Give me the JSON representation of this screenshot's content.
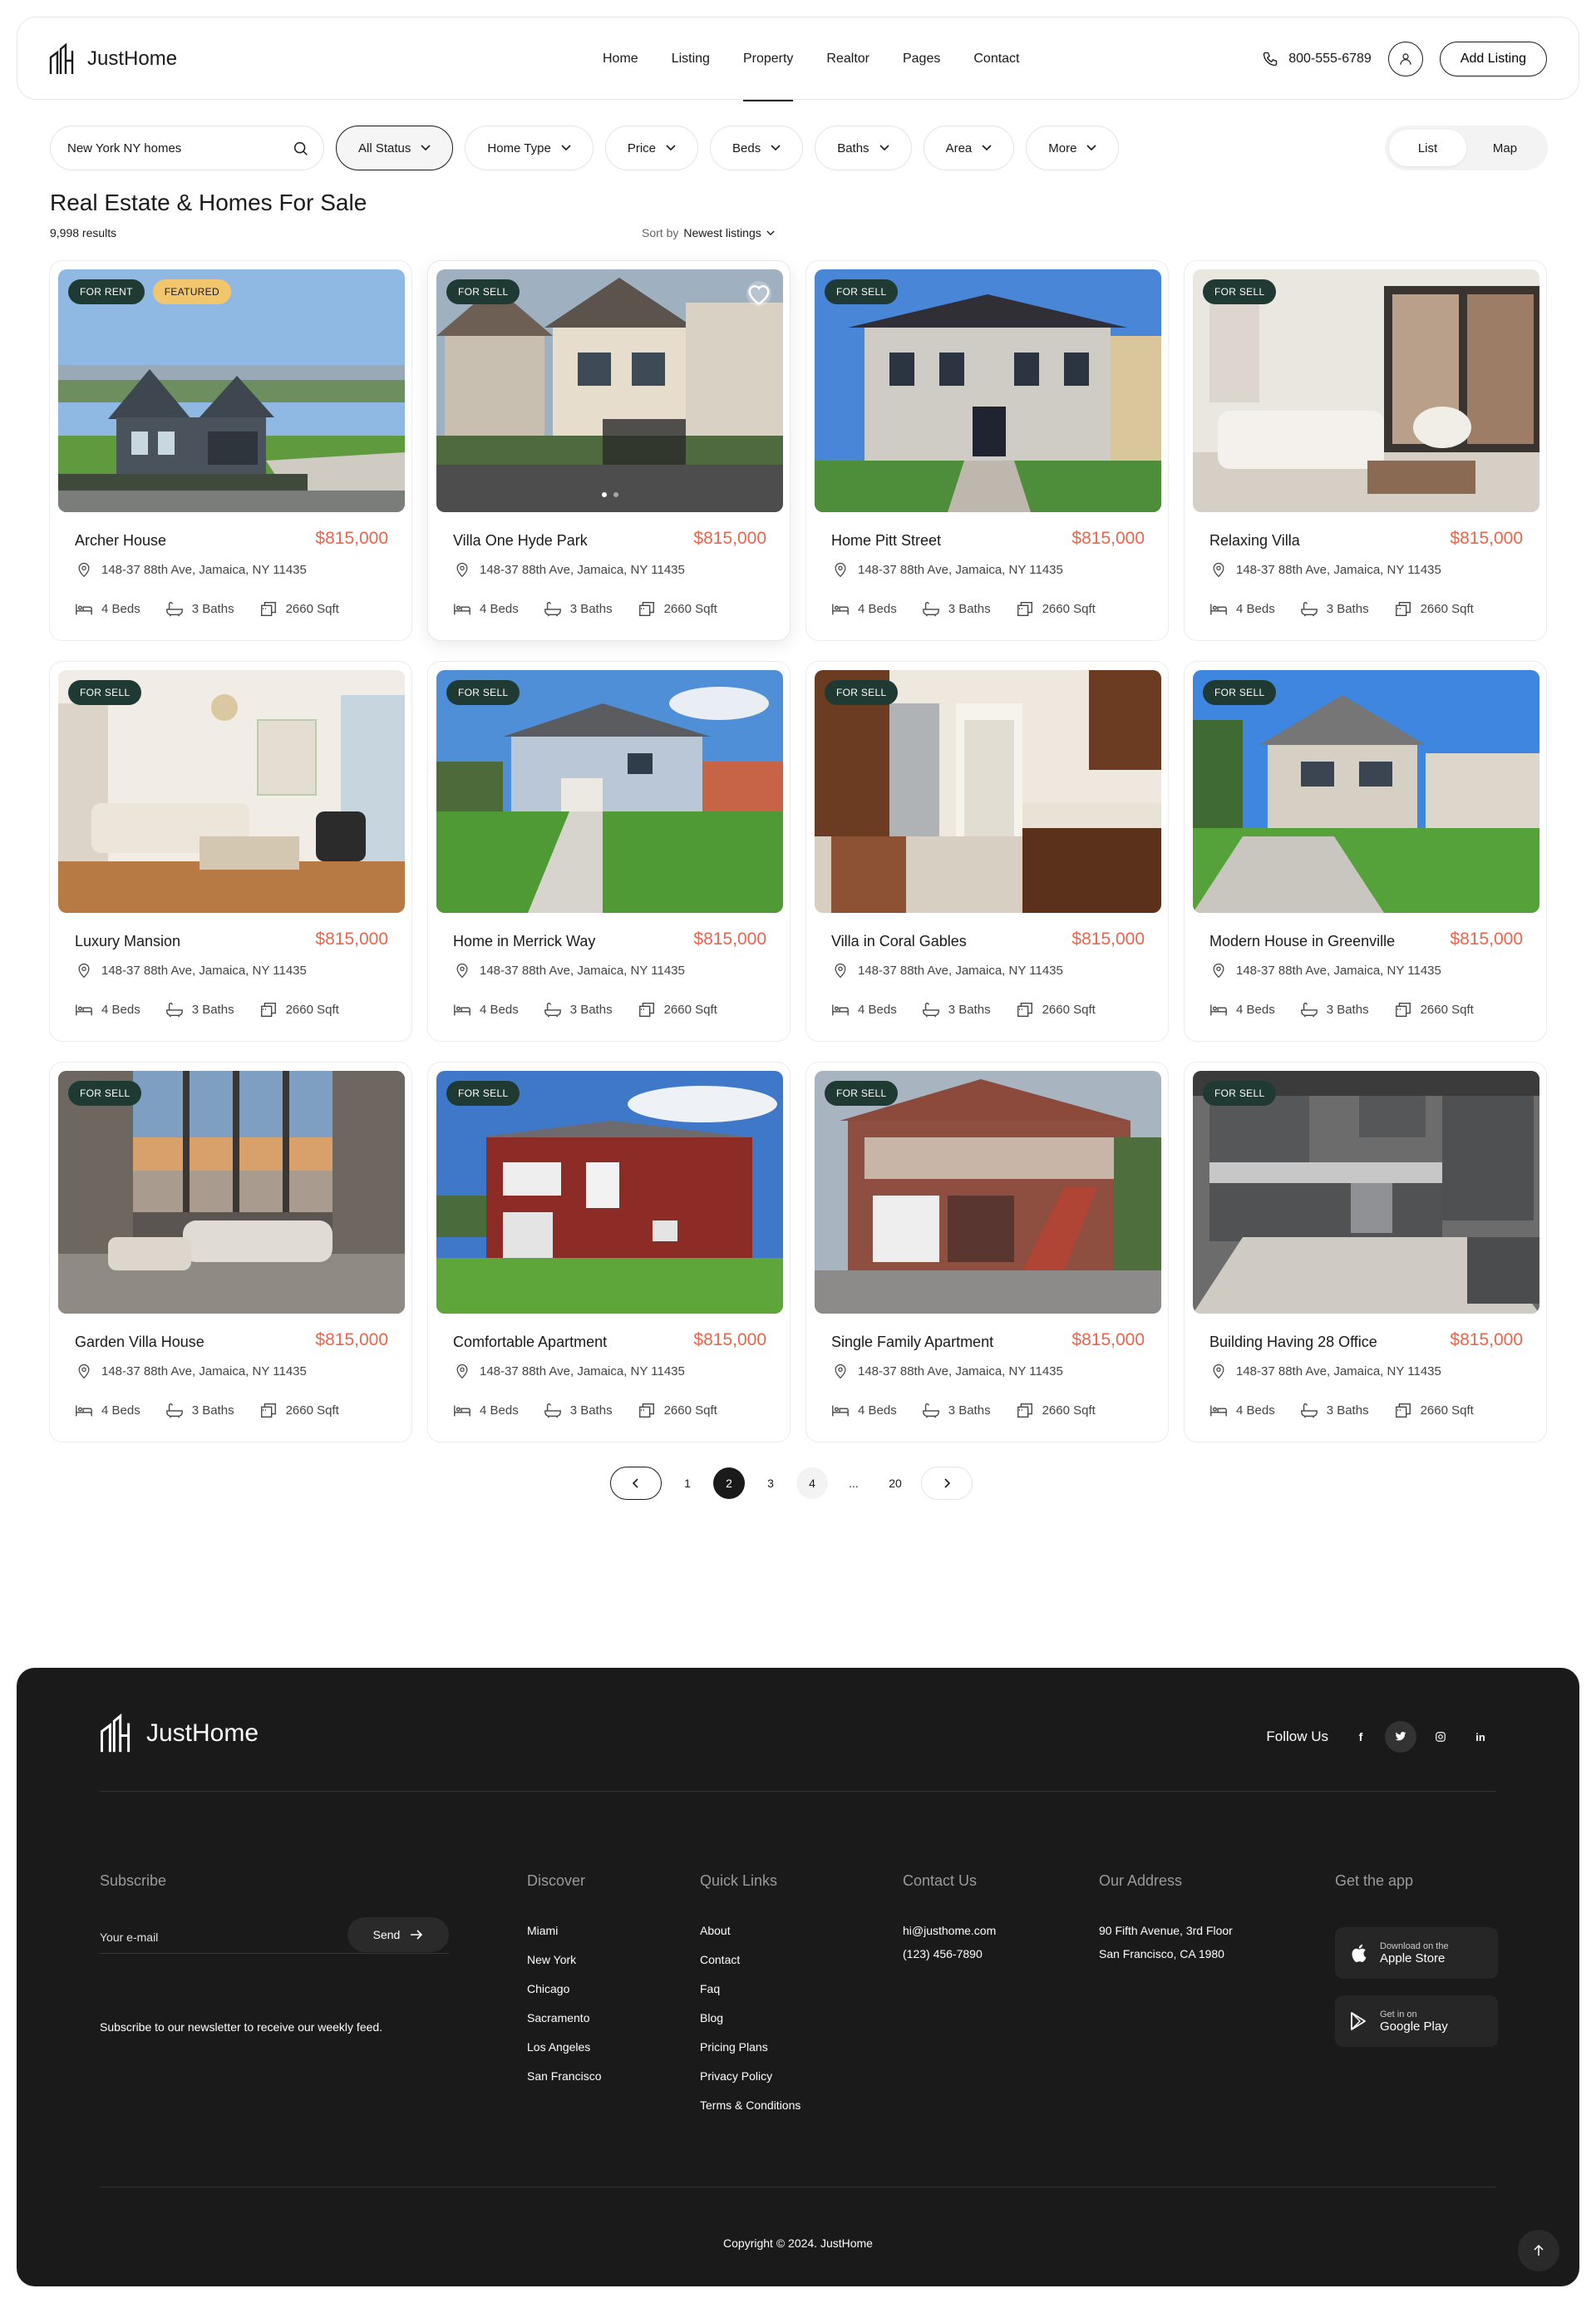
{
  "header": {
    "brand": "JustHome",
    "nav": [
      "Home",
      "Listing",
      "Property",
      "Realtor",
      "Pages",
      "Contact"
    ],
    "active_nav": "Property",
    "phone": "800-555-6789",
    "add_listing": "Add Listing"
  },
  "filters": {
    "search_value": "New York NY homes",
    "chips": [
      "All Status",
      "Home Type",
      "Price",
      "Beds",
      "Baths",
      "Area",
      "More"
    ],
    "selected_chip": "All Status",
    "view_options": [
      "List",
      "Map"
    ],
    "active_view": "List"
  },
  "listing": {
    "title": "Real Estate & Homes For Sale",
    "results": "9,998 results",
    "sort_label": "Sort by",
    "sort_value": "Newest listings"
  },
  "cards": [
    {
      "name": "Archer House",
      "price": "$815,000",
      "badges": [
        "FOR RENT",
        "FEATURED"
      ],
      "scene": "modern-dark-house"
    },
    {
      "name": "Villa One Hyde Park",
      "price": "$815,000",
      "badges": [
        "FOR SELL"
      ],
      "scene": "street-houses"
    },
    {
      "name": "Home Pitt Street",
      "price": "$815,000",
      "badges": [
        "FOR SELL"
      ],
      "scene": "mansion"
    },
    {
      "name": "Relaxing Villa",
      "price": "$815,000",
      "badges": [
        "FOR SELL"
      ],
      "scene": "living-room-white"
    },
    {
      "name": "Luxury Mansion",
      "price": "$815,000",
      "badges": [
        "FOR SELL"
      ],
      "scene": "living-room-warm"
    },
    {
      "name": "Home in Merrick Way",
      "price": "$815,000",
      "badges": [
        "FOR SELL"
      ],
      "scene": "suburban-house"
    },
    {
      "name": "Villa in Coral Gables",
      "price": "$815,000",
      "badges": [
        "FOR SELL"
      ],
      "scene": "kitchen-wood"
    },
    {
      "name": "Modern House in Greenville",
      "price": "$815,000",
      "badges": [
        "FOR SELL"
      ],
      "scene": "suburban-house-2"
    },
    {
      "name": "Garden Villa House",
      "price": "$815,000",
      "badges": [
        "FOR SELL"
      ],
      "scene": "penthouse"
    },
    {
      "name": "Comfortable Apartment",
      "price": "$815,000",
      "badges": [
        "FOR SELL"
      ],
      "scene": "red-house"
    },
    {
      "name": "Single Family Apartment",
      "price": "$815,000",
      "badges": [
        "FOR SELL"
      ],
      "scene": "brick-house"
    },
    {
      "name": "Building Having 28 Office",
      "price": "$815,000",
      "badges": [
        "FOR SELL"
      ],
      "scene": "kitchen-grey"
    }
  ],
  "card_common": {
    "address": "148-37 88th Ave, Jamaica, NY 11435",
    "beds": "4 Beds",
    "baths": "3 Baths",
    "area": "2660 Sqft"
  },
  "pagination": {
    "pages": [
      "1",
      "2",
      "3",
      "4",
      "...",
      "20"
    ],
    "current": "2"
  },
  "footer": {
    "brand": "JustHome",
    "follow_label": "Follow Us",
    "social_icons": [
      "facebook-icon",
      "twitter-icon",
      "instagram-icon",
      "linkedin-icon"
    ],
    "subscribe": {
      "title": "Subscribe",
      "placeholder": "Your e-mail",
      "button": "Send",
      "note": "Subscribe to our newsletter to receive our weekly feed."
    },
    "discover": {
      "title": "Discover",
      "items": [
        "Miami",
        "New York",
        "Chicago",
        "Sacramento",
        "Los Angeles",
        "San Francisco"
      ]
    },
    "quick_links": {
      "title": "Quick Links",
      "items": [
        "About",
        "Contact",
        "Faq",
        "Blog",
        "Pricing Plans",
        "Privacy Policy",
        "Terms & Conditions"
      ]
    },
    "contact": {
      "title": "Contact Us",
      "items": [
        "hi@justhome.com",
        "(123) 456-7890"
      ]
    },
    "address": {
      "title": "Our Address",
      "items": [
        "90 Fifth Avenue, 3rd Floor",
        "San Francisco, CA 1980"
      ]
    },
    "app": {
      "title": "Get the app",
      "apple_small": "Download on the",
      "apple_large": "Apple Store",
      "google_small": "Get in on",
      "google_large": "Google Play"
    },
    "copyright": "Copyright © 2024. JustHome"
  },
  "colors": {
    "accent_price": "#e8664d",
    "badge_status": "#1f3a33",
    "badge_featured": "#f2c66d",
    "footer_bg": "#1a1a1a"
  }
}
